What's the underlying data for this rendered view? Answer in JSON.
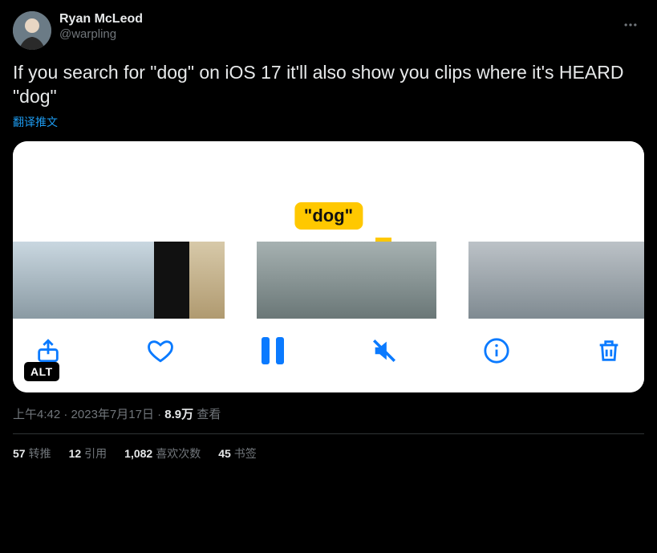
{
  "author": {
    "display_name": "Ryan McLeod",
    "handle": "@warpling"
  },
  "tweet_text": "If you search for \"dog\" on iOS 17 it'll also show you clips where it's HEARD \"dog\"",
  "translate_label": "翻译推文",
  "media": {
    "badge_text": "\"dog\"",
    "alt_label": "ALT",
    "toolbar": {
      "share": "share",
      "like": "like",
      "pause": "pause",
      "mute": "mute",
      "info": "info",
      "delete": "delete"
    }
  },
  "meta": {
    "time": "上午4:42",
    "sep1": " · ",
    "date": "2023年7月17日",
    "sep2": " · ",
    "views_num": "8.9万",
    "views_label": " 查看"
  },
  "stats": {
    "retweets": {
      "count": "57",
      "label": "转推"
    },
    "quotes": {
      "count": "12",
      "label": "引用"
    },
    "likes": {
      "count": "1,082",
      "label": "喜欢次数"
    },
    "bookmarks": {
      "count": "45",
      "label": "书签"
    }
  }
}
